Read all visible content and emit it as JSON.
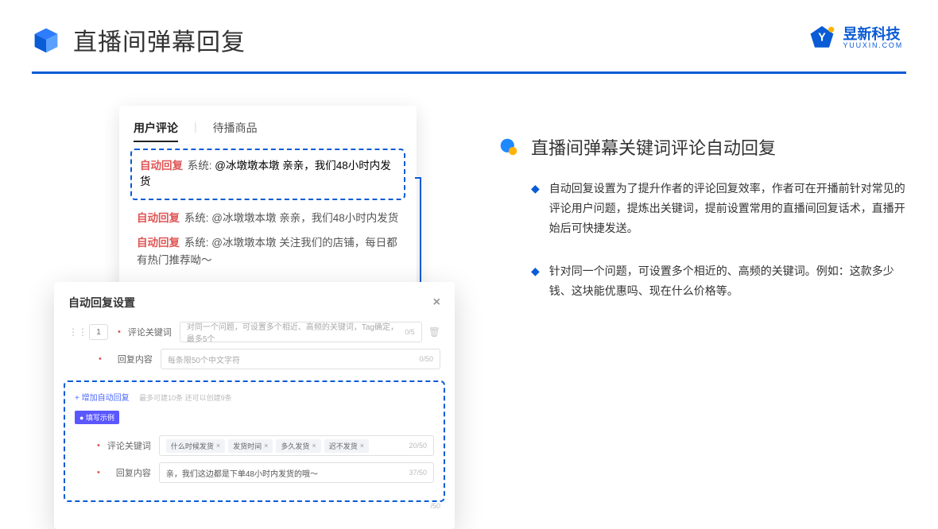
{
  "header": {
    "title": "直播间弹幕回复"
  },
  "brand": {
    "name": "昱新科技",
    "sub": "YUUXIN.COM"
  },
  "commentPanel": {
    "tabs": {
      "active": "用户评论",
      "inactive": "待播商品"
    },
    "highlight": {
      "auto": "自动回复",
      "sys": "系统:",
      "body": "@冰墩墩本墩 亲亲，我们48小时内发货"
    },
    "line2": {
      "auto": "自动回复",
      "sys": "系统:",
      "body": "@冰墩墩本墩 亲亲，我们48小时内发货"
    },
    "line3": {
      "auto": "自动回复",
      "sys": "系统:",
      "body": "@冰墩墩本墩 关注我们的店铺，每日都有热门推荐呦～"
    }
  },
  "modal": {
    "title": "自动回复设置",
    "num": "1",
    "kwLabel": "评论关键词",
    "kwPlaceholder": "对同一个问题，可设置多个相近、高频的关键词，Tag确定，最多5个",
    "kwCount": "0/5",
    "replyLabel": "回复内容",
    "replyPlaceholder": "每条限50个中文字符",
    "replyCount": "0/50",
    "addLink": "+ 增加自动回复",
    "addHint": "最多可建10条 还可以创建9条",
    "exampleBadge": "● 填写示例",
    "exKwLabel": "评论关键词",
    "exChips": [
      "什么时候发货",
      "发货时间",
      "多久发货",
      "迟不发货"
    ],
    "exKwCount": "20/50",
    "exReplyLabel": "回复内容",
    "exReplyText": "亲，我们这边都是下单48小时内发货的哦～",
    "exReplyCount": "37/50",
    "outerCount": "/50"
  },
  "right": {
    "title": "直播间弹幕关键词评论自动回复",
    "b1": "自动回复设置为了提升作者的评论回复效率，作者可在开播前针对常见的评论用户问题，提炼出关键词，提前设置常用的直播间回复话术，直播开始后可快捷发送。",
    "b2": "针对同一个问题，可设置多个相近的、高频的关键词。例如：这款多少钱、这块能优惠吗、现在什么价格等。"
  }
}
